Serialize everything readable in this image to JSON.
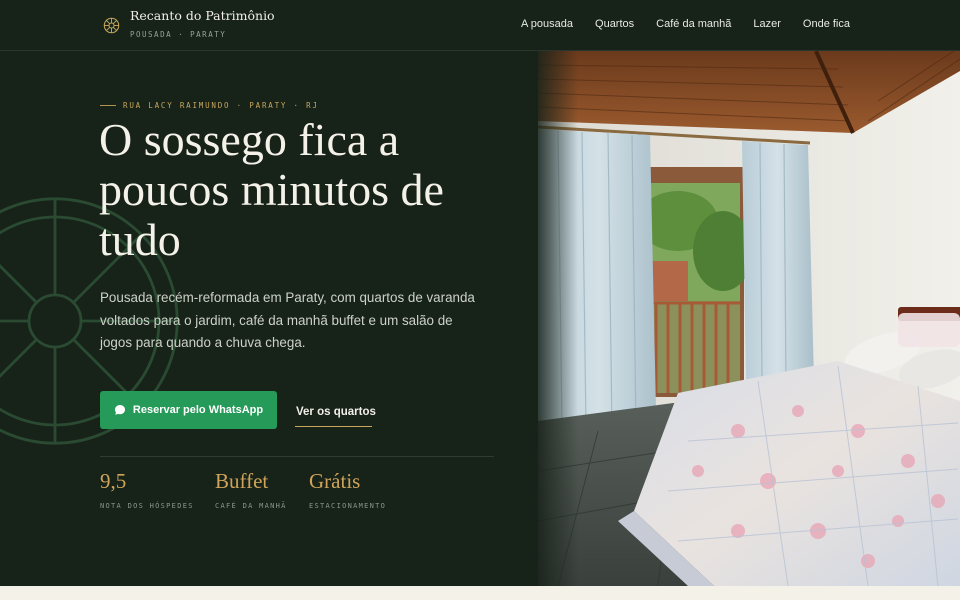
{
  "brand": {
    "name": "Recanto do Patrimônio",
    "subtitle": "POUSADA · PARATY"
  },
  "nav": {
    "items": [
      {
        "label": "A pousada"
      },
      {
        "label": "Quartos"
      },
      {
        "label": "Café da manhã"
      },
      {
        "label": "Lazer"
      },
      {
        "label": "Onde fica"
      }
    ]
  },
  "hero": {
    "eyebrow": "RUA LACY RAIMUNDO · PARATY · RJ",
    "headline": "O sossego fica a poucos minutos de tudo",
    "lede": "Pousada recém-reformada em Paraty, com quartos de varanda voltados para o jardim, café da manhã buffet e um salão de jogos para quando a chuva chega.",
    "cta_label": "Reservar pelo WhatsApp",
    "secondary_label": "Ver os quartos",
    "photo_icon": "guest-room-photo"
  },
  "stats": [
    {
      "value": "9,5",
      "label": "NOTA DOS HÓSPEDES"
    },
    {
      "value": "Buffet",
      "label": "CAFÉ DA MANHÃ"
    },
    {
      "value": "Grátis",
      "label": "ESTACIONAMENTO"
    }
  ],
  "colors": {
    "background": "#172219",
    "accent_gold": "#c7a75c",
    "whatsapp_green": "#259a59",
    "cream": "#f4f1e8"
  },
  "icons": {
    "brand": "wheel-logo-icon",
    "cta": "whatsapp-chat-icon",
    "decor": "wheel-decoration-icon"
  }
}
